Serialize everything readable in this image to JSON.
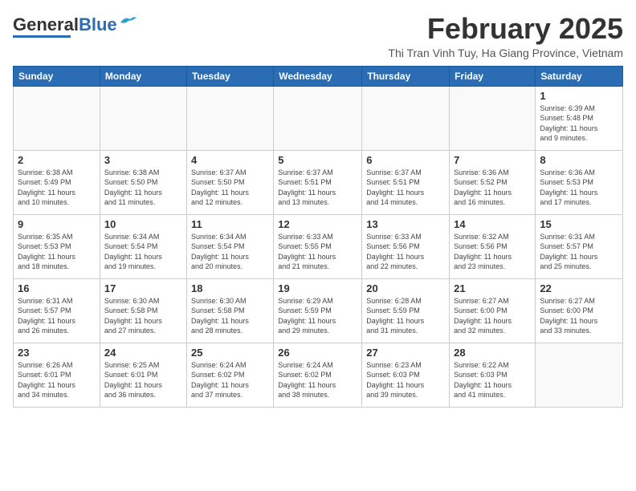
{
  "logo": {
    "general": "General",
    "blue": "Blue"
  },
  "title": "February 2025",
  "location": "Thi Tran Vinh Tuy, Ha Giang Province, Vietnam",
  "days_of_week": [
    "Sunday",
    "Monday",
    "Tuesday",
    "Wednesday",
    "Thursday",
    "Friday",
    "Saturday"
  ],
  "weeks": [
    [
      {
        "day": "",
        "info": ""
      },
      {
        "day": "",
        "info": ""
      },
      {
        "day": "",
        "info": ""
      },
      {
        "day": "",
        "info": ""
      },
      {
        "day": "",
        "info": ""
      },
      {
        "day": "",
        "info": ""
      },
      {
        "day": "1",
        "info": "Sunrise: 6:39 AM\nSunset: 5:48 PM\nDaylight: 11 hours\nand 9 minutes."
      }
    ],
    [
      {
        "day": "2",
        "info": "Sunrise: 6:38 AM\nSunset: 5:49 PM\nDaylight: 11 hours\nand 10 minutes."
      },
      {
        "day": "3",
        "info": "Sunrise: 6:38 AM\nSunset: 5:50 PM\nDaylight: 11 hours\nand 11 minutes."
      },
      {
        "day": "4",
        "info": "Sunrise: 6:37 AM\nSunset: 5:50 PM\nDaylight: 11 hours\nand 12 minutes."
      },
      {
        "day": "5",
        "info": "Sunrise: 6:37 AM\nSunset: 5:51 PM\nDaylight: 11 hours\nand 13 minutes."
      },
      {
        "day": "6",
        "info": "Sunrise: 6:37 AM\nSunset: 5:51 PM\nDaylight: 11 hours\nand 14 minutes."
      },
      {
        "day": "7",
        "info": "Sunrise: 6:36 AM\nSunset: 5:52 PM\nDaylight: 11 hours\nand 16 minutes."
      },
      {
        "day": "8",
        "info": "Sunrise: 6:36 AM\nSunset: 5:53 PM\nDaylight: 11 hours\nand 17 minutes."
      }
    ],
    [
      {
        "day": "9",
        "info": "Sunrise: 6:35 AM\nSunset: 5:53 PM\nDaylight: 11 hours\nand 18 minutes."
      },
      {
        "day": "10",
        "info": "Sunrise: 6:34 AM\nSunset: 5:54 PM\nDaylight: 11 hours\nand 19 minutes."
      },
      {
        "day": "11",
        "info": "Sunrise: 6:34 AM\nSunset: 5:54 PM\nDaylight: 11 hours\nand 20 minutes."
      },
      {
        "day": "12",
        "info": "Sunrise: 6:33 AM\nSunset: 5:55 PM\nDaylight: 11 hours\nand 21 minutes."
      },
      {
        "day": "13",
        "info": "Sunrise: 6:33 AM\nSunset: 5:56 PM\nDaylight: 11 hours\nand 22 minutes."
      },
      {
        "day": "14",
        "info": "Sunrise: 6:32 AM\nSunset: 5:56 PM\nDaylight: 11 hours\nand 23 minutes."
      },
      {
        "day": "15",
        "info": "Sunrise: 6:31 AM\nSunset: 5:57 PM\nDaylight: 11 hours\nand 25 minutes."
      }
    ],
    [
      {
        "day": "16",
        "info": "Sunrise: 6:31 AM\nSunset: 5:57 PM\nDaylight: 11 hours\nand 26 minutes."
      },
      {
        "day": "17",
        "info": "Sunrise: 6:30 AM\nSunset: 5:58 PM\nDaylight: 11 hours\nand 27 minutes."
      },
      {
        "day": "18",
        "info": "Sunrise: 6:30 AM\nSunset: 5:58 PM\nDaylight: 11 hours\nand 28 minutes."
      },
      {
        "day": "19",
        "info": "Sunrise: 6:29 AM\nSunset: 5:59 PM\nDaylight: 11 hours\nand 29 minutes."
      },
      {
        "day": "20",
        "info": "Sunrise: 6:28 AM\nSunset: 5:59 PM\nDaylight: 11 hours\nand 31 minutes."
      },
      {
        "day": "21",
        "info": "Sunrise: 6:27 AM\nSunset: 6:00 PM\nDaylight: 11 hours\nand 32 minutes."
      },
      {
        "day": "22",
        "info": "Sunrise: 6:27 AM\nSunset: 6:00 PM\nDaylight: 11 hours\nand 33 minutes."
      }
    ],
    [
      {
        "day": "23",
        "info": "Sunrise: 6:26 AM\nSunset: 6:01 PM\nDaylight: 11 hours\nand 34 minutes."
      },
      {
        "day": "24",
        "info": "Sunrise: 6:25 AM\nSunset: 6:01 PM\nDaylight: 11 hours\nand 36 minutes."
      },
      {
        "day": "25",
        "info": "Sunrise: 6:24 AM\nSunset: 6:02 PM\nDaylight: 11 hours\nand 37 minutes."
      },
      {
        "day": "26",
        "info": "Sunrise: 6:24 AM\nSunset: 6:02 PM\nDaylight: 11 hours\nand 38 minutes."
      },
      {
        "day": "27",
        "info": "Sunrise: 6:23 AM\nSunset: 6:03 PM\nDaylight: 11 hours\nand 39 minutes."
      },
      {
        "day": "28",
        "info": "Sunrise: 6:22 AM\nSunset: 6:03 PM\nDaylight: 11 hours\nand 41 minutes."
      },
      {
        "day": "",
        "info": ""
      }
    ]
  ]
}
